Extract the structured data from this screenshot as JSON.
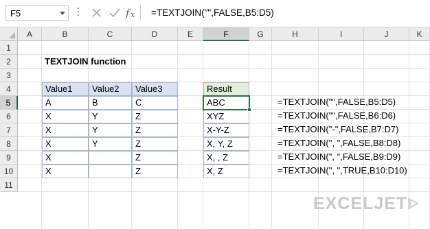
{
  "formula_bar": {
    "name_box": "F5",
    "formula": "=TEXTJOIN(\"\",FALSE,B5:D5)",
    "cancel_icon": "close-icon",
    "enter_icon": "check-icon",
    "function_icon": "fx-icon"
  },
  "grid": {
    "columns": [
      "A",
      "B",
      "C",
      "D",
      "E",
      "F",
      "G",
      "H",
      "I",
      "J",
      "K"
    ],
    "rows": [
      "1",
      "2",
      "3",
      "4",
      "5",
      "6",
      "7",
      "8",
      "9",
      "10",
      "11"
    ],
    "selected_column": "F",
    "selected_row": "5"
  },
  "sheet": {
    "title": "TEXTJOIN function",
    "table_headers": [
      "Value1",
      "Value2",
      "Value3"
    ],
    "table_rows": [
      [
        "A",
        "B",
        "C"
      ],
      [
        "X",
        "Y",
        "Z"
      ],
      [
        "X",
        "Y",
        "Z"
      ],
      [
        "X",
        "Y",
        "Z"
      ],
      [
        "X",
        "",
        "Z"
      ],
      [
        "X",
        "",
        "Z"
      ]
    ],
    "result_header": "Result",
    "results": [
      "ABC",
      "XYZ",
      "X-Y-Z",
      "X, Y, Z",
      "X, , Z",
      "X, Z"
    ],
    "formulas": [
      "=TEXTJOIN(\"\",FALSE,B5:D5)",
      "=TEXTJOIN(\"\",FALSE,B6:D6)",
      "=TEXTJOIN(\"-\",FALSE,B7:D7)",
      "=TEXTJOIN(\", \",FALSE,B8:D8)",
      "=TEXTJOIN(\", \",FALSE,B9:D9)",
      "=TEXTJOIN(\", \",TRUE,B10:D10)"
    ]
  },
  "colors": {
    "selection": "#217346",
    "table_header_fill": "#d9e1f2",
    "result_header_fill": "#e2efda"
  },
  "watermark": {
    "text": "EXCELJET"
  }
}
